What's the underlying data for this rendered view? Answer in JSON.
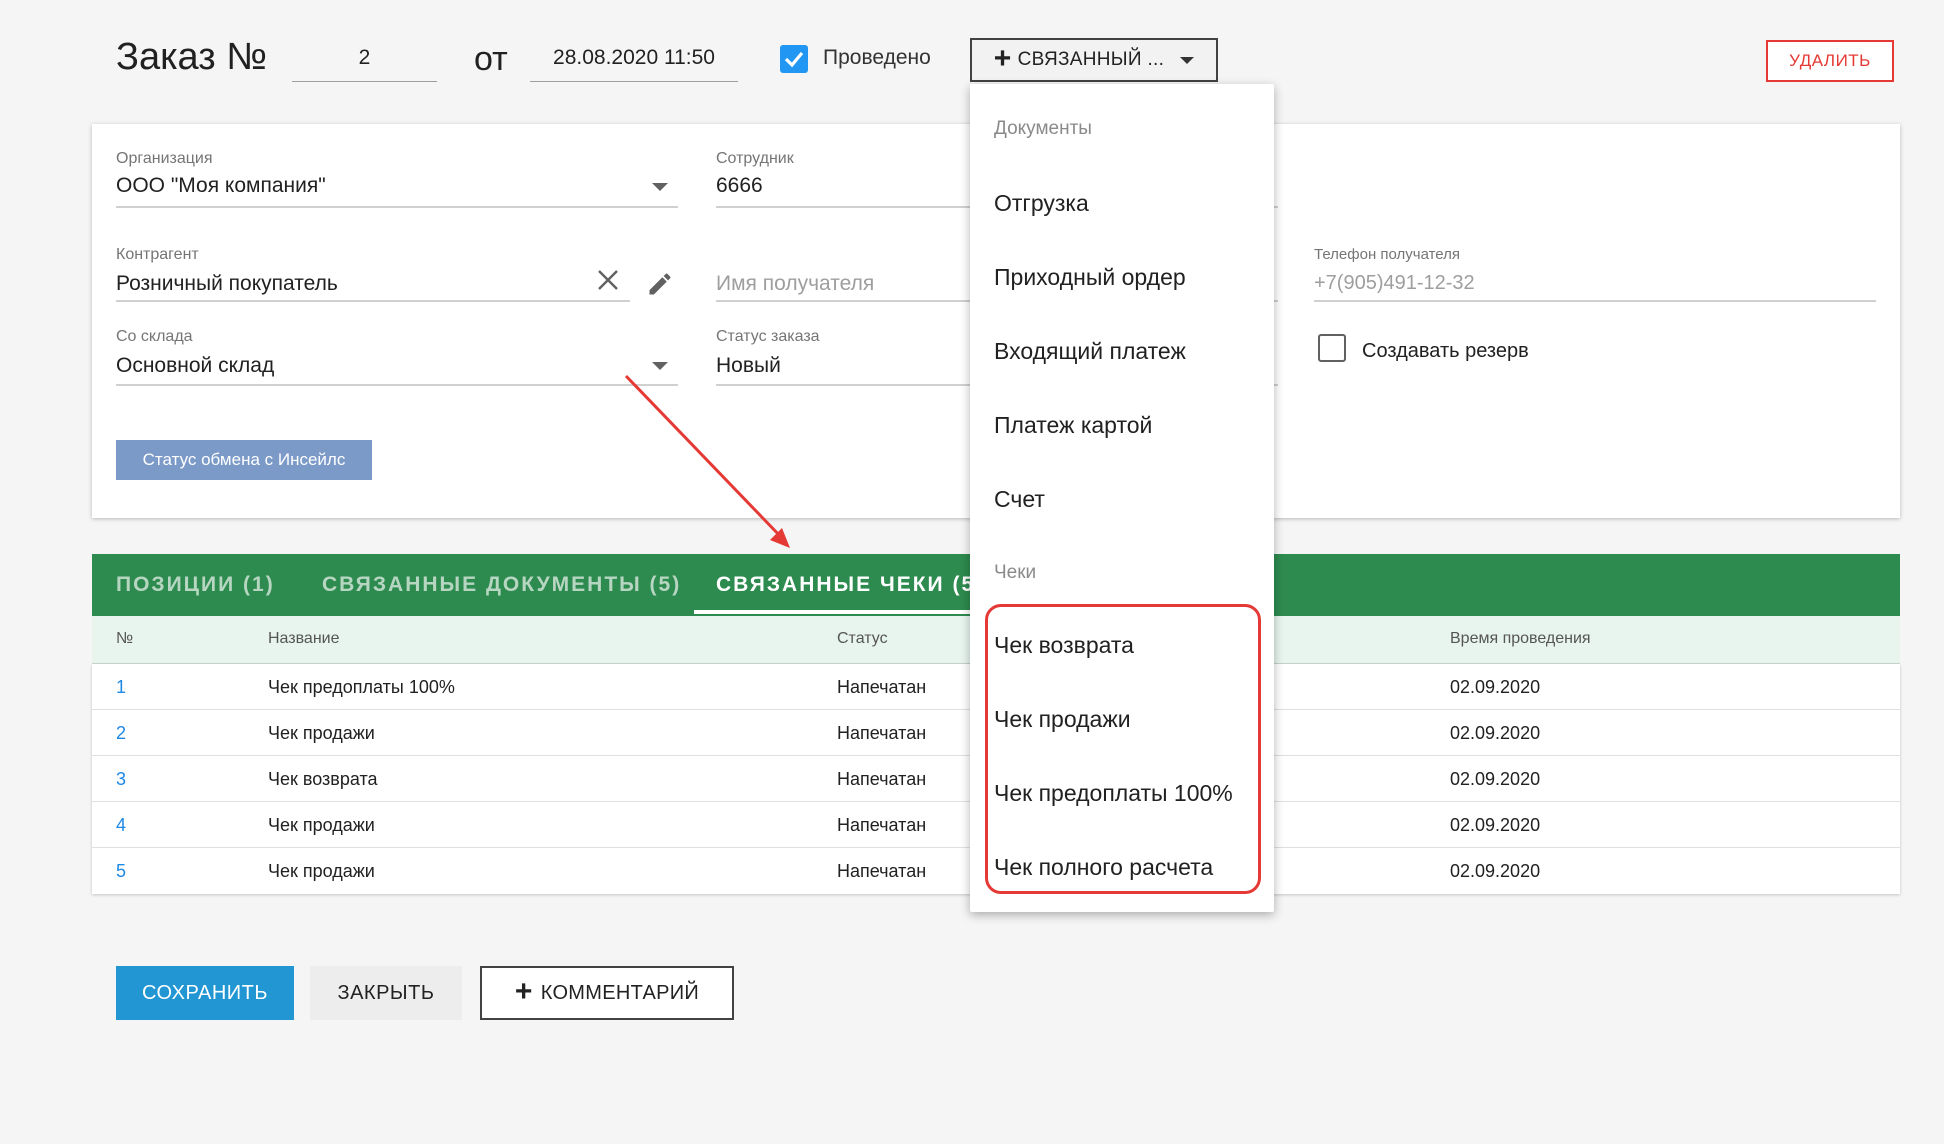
{
  "header": {
    "title": "Заказ №",
    "order_number": "2",
    "from_label": "от",
    "date": "28.08.2020 11:50",
    "posted_label": "Проведено",
    "linked_button": "СВЯЗАННЫЙ ...",
    "delete_button": "УДАЛИТЬ"
  },
  "form": {
    "organization_label": "Организация",
    "organization_value": "ООО \"Моя компания\"",
    "employee_label": "Сотрудник",
    "employee_value": "6666",
    "counterparty_label": "Контрагент",
    "counterparty_value": "Розничный покупатель",
    "recipient_placeholder": "Имя получателя",
    "recipient_phone_label": "Телефон получателя",
    "recipient_phone_placeholder": "+7(905)491-12-32",
    "warehouse_label": "Со склада",
    "warehouse_value": "Основной склад",
    "status_label": "Статус заказа",
    "status_value": "Новый",
    "reserve_label": "Создавать резерв",
    "exchange_button": "Статус обмена с Инсейлс"
  },
  "tabs": [
    {
      "label": "ПОЗИЦИИ (1)"
    },
    {
      "label": "СВЯЗАННЫЕ ДОКУМЕНТЫ (5)"
    },
    {
      "label": "СВЯЗАННЫЕ ЧЕКИ (5)"
    }
  ],
  "table": {
    "headers": [
      "№",
      "Название",
      "Статус",
      "Время проведения"
    ],
    "rows": [
      {
        "num": "1",
        "name": "Чек предоплаты 100%",
        "status": "Напечатан",
        "time": "02.09.2020"
      },
      {
        "num": "2",
        "name": "Чек продажи",
        "status": "Напечатан",
        "time": "02.09.2020"
      },
      {
        "num": "3",
        "name": "Чек возврата",
        "status": "Напечатан",
        "time": "02.09.2020"
      },
      {
        "num": "4",
        "name": "Чек продажи",
        "status": "Напечатан",
        "time": "02.09.2020"
      },
      {
        "num": "5",
        "name": "Чек продажи",
        "status": "Напечатан",
        "time": "02.09.2020"
      }
    ]
  },
  "menu": {
    "documents_header": "Документы",
    "documents": [
      "Отгрузка",
      "Приходный ордер",
      "Входящий платеж",
      "Платеж картой",
      "Счет"
    ],
    "receipts_header": "Чеки",
    "receipts": [
      "Чек возврата",
      "Чек продажи",
      "Чек предоплаты 100%",
      "Чек полного расчета"
    ]
  },
  "footer": {
    "save_button": "СОХРАНИТЬ",
    "close_button": "ЗАКРЫТЬ",
    "comment_button": "КОММЕНТАРИЙ"
  },
  "colors": {
    "accent": "#2196f3",
    "tabbar": "#2e8b4f",
    "danger": "#e53935"
  }
}
